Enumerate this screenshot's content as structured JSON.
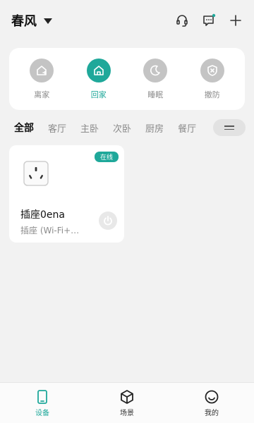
{
  "header": {
    "home_name": "春风",
    "icons": [
      "chevron-down-icon",
      "headset-icon",
      "message-icon",
      "add-icon"
    ]
  },
  "modes": [
    {
      "label": "离家",
      "icon": "away-home-icon",
      "active": false
    },
    {
      "label": "回家",
      "icon": "home-icon",
      "active": true
    },
    {
      "label": "睡眠",
      "icon": "moon-icon",
      "active": false
    },
    {
      "label": "撤防",
      "icon": "shield-off-icon",
      "active": false
    }
  ],
  "rooms": {
    "tabs": [
      "全部",
      "客厅",
      "主卧",
      "次卧",
      "厨房",
      "餐厅"
    ],
    "active_tab": "全部",
    "more_icon": "menu-icon"
  },
  "devices": [
    {
      "name": "插座0ena",
      "type": "插座 (Wi-Fi+…",
      "status": "在线",
      "icon": "socket-icon"
    }
  ],
  "bottom_nav": [
    {
      "label": "设备",
      "icon": "phone-icon",
      "active": true
    },
    {
      "label": "场景",
      "icon": "cube-icon",
      "active": false
    },
    {
      "label": "我的",
      "icon": "smile-icon",
      "active": false
    }
  ],
  "colors": {
    "accent": "#1fa89a",
    "inactive_icon": "#c4c4c4",
    "background": "#f2f2f2"
  }
}
